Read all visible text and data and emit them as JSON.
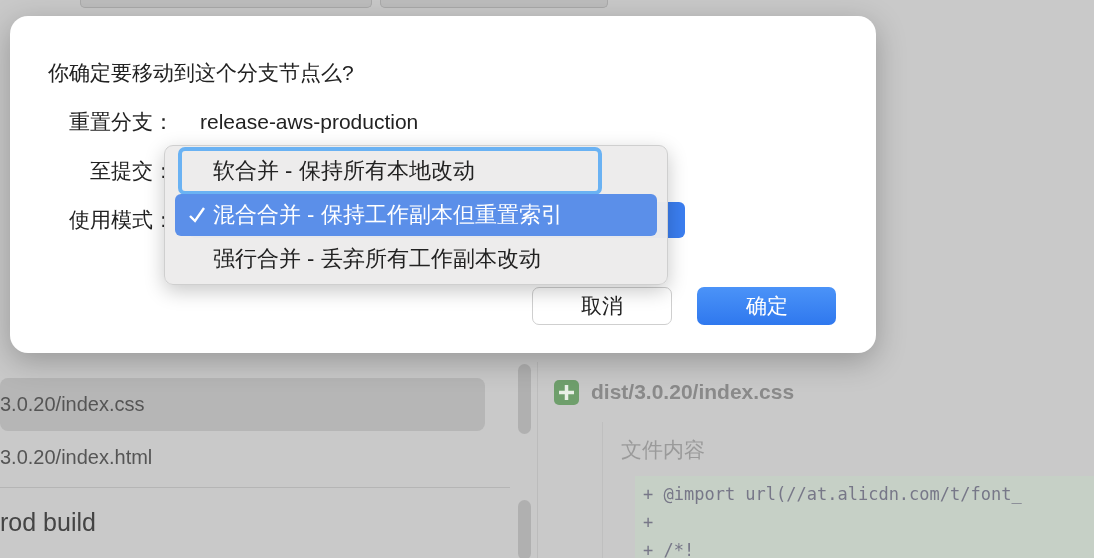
{
  "app": {
    "file_list": [
      {
        "name": "3.0.20/index.css",
        "selected": true
      },
      {
        "name": "3.0.20/index.html",
        "selected": false
      }
    ],
    "commit_group": "rod build",
    "diff": {
      "file": "dist/3.0.20/index.css",
      "section": "文件内容",
      "lines": [
        "+ @import url(//at.alicdn.com/t/font_",
        "+",
        "+ /*!"
      ]
    }
  },
  "dialog": {
    "message": "你确定要移动到这个分支节点么?",
    "fields": [
      {
        "label": "重置分支：",
        "value": "release-aws-production"
      },
      {
        "label": "至提交："
      },
      {
        "label": "使用模式："
      }
    ],
    "buttons": [
      {
        "label": "取消",
        "kind": "secondary"
      },
      {
        "label": "确定",
        "kind": "primary"
      }
    ]
  },
  "mode_menu": {
    "items": [
      {
        "label": "软合并 - 保持所有本地改动",
        "selected": false,
        "focused": true
      },
      {
        "label": "混合合并 - 保持工作副本但重置索引",
        "selected": true,
        "focused": false
      },
      {
        "label": "强行合并 - 丢弃所有工作副本改动",
        "selected": false,
        "focused": false
      }
    ]
  }
}
